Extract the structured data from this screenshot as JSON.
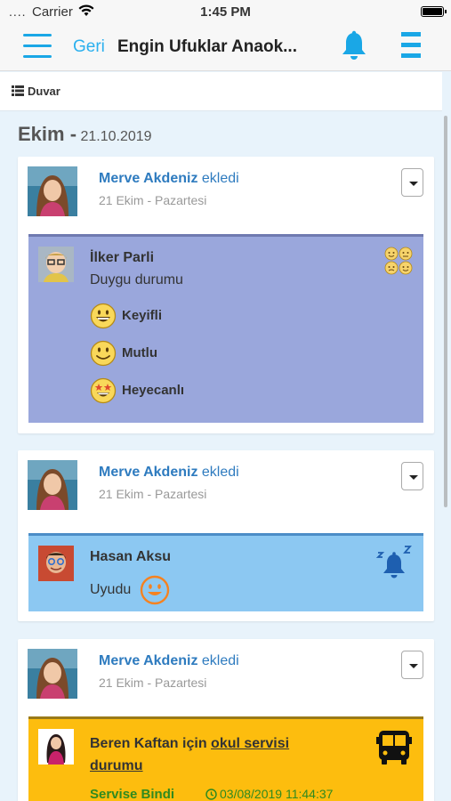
{
  "status_bar": {
    "signal": "....",
    "carrier": "Carrier",
    "time": "1:45 PM"
  },
  "nav": {
    "back_label": "Geri",
    "title": "Engin Ufuklar Anaok..."
  },
  "breadcrumb": {
    "label": "Duvar"
  },
  "section": {
    "month": "Ekim -",
    "date": "21.10.2019"
  },
  "colors": {
    "accent": "#1aa7e6",
    "author": "#2e7bbf",
    "mood_panel": "#9aa7dc",
    "sleep_panel": "#8cc8f2",
    "bus_panel": "#fdbd0e",
    "status_green": "#2f8a1f"
  },
  "posts": [
    {
      "author": "Merve Akdeniz",
      "action": "ekledi",
      "date": "21 Ekim - Pazartesi",
      "panel": {
        "type": "mood",
        "kid": "İlker Parli",
        "subtitle": "Duygu durumu",
        "moods": [
          {
            "label": "Keyifli",
            "icon": "grin-face-icon"
          },
          {
            "label": "Mutlu",
            "icon": "smile-face-icon"
          },
          {
            "label": "Heyecanlı",
            "icon": "star-eyes-face-icon"
          }
        ]
      }
    },
    {
      "author": "Merve Akdeniz",
      "action": "ekledi",
      "date": "21 Ekim - Pazartesi",
      "panel": {
        "type": "sleep",
        "kid": "Hasan Aksu",
        "label": "Uyudu",
        "icon": "sleep-bell-icon"
      }
    },
    {
      "author": "Merve Akdeniz",
      "action": "ekledi",
      "date": "21 Ekim - Pazartesi",
      "panel": {
        "type": "bus",
        "kid_prefix": "Beren Kaftan için",
        "link": "okul servisi durumu",
        "status": "Servise Bindi",
        "timestamp": "03/08/2019 11:44:37",
        "icon": "bus-icon"
      }
    }
  ]
}
